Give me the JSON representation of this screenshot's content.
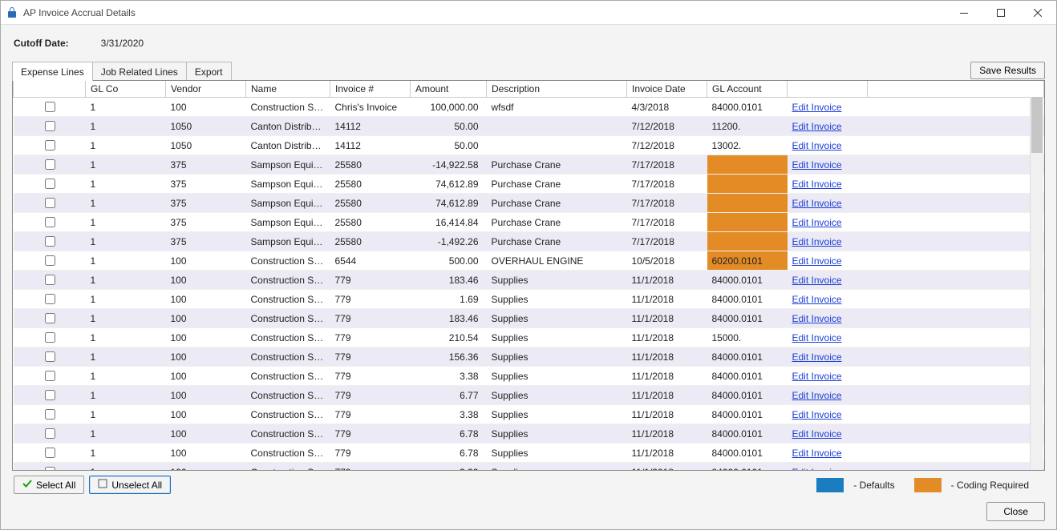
{
  "window": {
    "title": "AP Invoice Accrual Details"
  },
  "win_controls": {
    "min": "—",
    "max": "▢",
    "close": "✕"
  },
  "cutoff": {
    "label": "Cutoff Date:",
    "value": "3/31/2020"
  },
  "tabs": [
    {
      "label": "Expense Lines",
      "active": true
    },
    {
      "label": "Job Related Lines",
      "active": false
    },
    {
      "label": "Export",
      "active": false
    }
  ],
  "save_button": "Save Results",
  "columns": [
    "",
    "GL Co",
    "Vendor",
    "Name",
    "Invoice #",
    "Amount",
    "Description",
    "Invoice Date",
    "GL Account",
    "",
    ""
  ],
  "edit_link_label": "Edit Invoice",
  "rows": [
    {
      "glco": "1",
      "vendor": "100",
      "name": "Construction Sup...",
      "inv": "Chris's Invoice",
      "amount": "100,000.00",
      "desc": "wfsdf",
      "date": "4/3/2018",
      "gl": "84000.0101",
      "gl_hl": false
    },
    {
      "glco": "1",
      "vendor": "1050",
      "name": "Canton Distributin...",
      "inv": "14112",
      "amount": "50.00",
      "desc": "",
      "date": "7/12/2018",
      "gl": "11200.",
      "gl_hl": false
    },
    {
      "glco": "1",
      "vendor": "1050",
      "name": "Canton Distributin...",
      "inv": "14112",
      "amount": "50.00",
      "desc": "",
      "date": "7/12/2018",
      "gl": "13002.",
      "gl_hl": false
    },
    {
      "glco": "1",
      "vendor": "375",
      "name": "Sampson Equipm...",
      "inv": "25580",
      "amount": "-14,922.58",
      "desc": "Purchase Crane",
      "date": "7/17/2018",
      "gl": "",
      "gl_hl": true
    },
    {
      "glco": "1",
      "vendor": "375",
      "name": "Sampson Equipm...",
      "inv": "25580",
      "amount": "74,612.89",
      "desc": "Purchase Crane",
      "date": "7/17/2018",
      "gl": "",
      "gl_hl": true
    },
    {
      "glco": "1",
      "vendor": "375",
      "name": "Sampson Equipm...",
      "inv": "25580",
      "amount": "74,612.89",
      "desc": "Purchase Crane",
      "date": "7/17/2018",
      "gl": "",
      "gl_hl": true
    },
    {
      "glco": "1",
      "vendor": "375",
      "name": "Sampson Equipm...",
      "inv": "25580",
      "amount": "16,414.84",
      "desc": "Purchase Crane",
      "date": "7/17/2018",
      "gl": "",
      "gl_hl": true
    },
    {
      "glco": "1",
      "vendor": "375",
      "name": "Sampson Equipm...",
      "inv": "25580",
      "amount": "-1,492.26",
      "desc": "Purchase Crane",
      "date": "7/17/2018",
      "gl": "",
      "gl_hl": true
    },
    {
      "glco": "1",
      "vendor": "100",
      "name": "Construction Sup...",
      "inv": "6544",
      "amount": "500.00",
      "desc": "OVERHAUL ENGINE",
      "date": "10/5/2018",
      "gl": "60200.0101",
      "gl_hl": true
    },
    {
      "glco": "1",
      "vendor": "100",
      "name": "Construction Sup...",
      "inv": "779",
      "amount": "183.46",
      "desc": "Supplies",
      "date": "11/1/2018",
      "gl": "84000.0101",
      "gl_hl": false
    },
    {
      "glco": "1",
      "vendor": "100",
      "name": "Construction Sup...",
      "inv": "779",
      "amount": "1.69",
      "desc": "Supplies",
      "date": "11/1/2018",
      "gl": "84000.0101",
      "gl_hl": false
    },
    {
      "glco": "1",
      "vendor": "100",
      "name": "Construction Sup...",
      "inv": "779",
      "amount": "183.46",
      "desc": "Supplies",
      "date": "11/1/2018",
      "gl": "84000.0101",
      "gl_hl": false
    },
    {
      "glco": "1",
      "vendor": "100",
      "name": "Construction Sup...",
      "inv": "779",
      "amount": "210.54",
      "desc": "Supplies",
      "date": "11/1/2018",
      "gl": "15000.",
      "gl_hl": false
    },
    {
      "glco": "1",
      "vendor": "100",
      "name": "Construction Sup...",
      "inv": "779",
      "amount": "156.36",
      "desc": "Supplies",
      "date": "11/1/2018",
      "gl": "84000.0101",
      "gl_hl": false
    },
    {
      "glco": "1",
      "vendor": "100",
      "name": "Construction Sup...",
      "inv": "779",
      "amount": "3.38",
      "desc": "Supplies",
      "date": "11/1/2018",
      "gl": "84000.0101",
      "gl_hl": false
    },
    {
      "glco": "1",
      "vendor": "100",
      "name": "Construction Sup...",
      "inv": "779",
      "amount": "6.77",
      "desc": "Supplies",
      "date": "11/1/2018",
      "gl": "84000.0101",
      "gl_hl": false
    },
    {
      "glco": "1",
      "vendor": "100",
      "name": "Construction Sup...",
      "inv": "779",
      "amount": "3.38",
      "desc": "Supplies",
      "date": "11/1/2018",
      "gl": "84000.0101",
      "gl_hl": false
    },
    {
      "glco": "1",
      "vendor": "100",
      "name": "Construction Sup...",
      "inv": "779",
      "amount": "6.78",
      "desc": "Supplies",
      "date": "11/1/2018",
      "gl": "84000.0101",
      "gl_hl": false
    },
    {
      "glco": "1",
      "vendor": "100",
      "name": "Construction Sup...",
      "inv": "779",
      "amount": "6.78",
      "desc": "Supplies",
      "date": "11/1/2018",
      "gl": "84000.0101",
      "gl_hl": false
    },
    {
      "glco": "1",
      "vendor": "100",
      "name": "Construction Sup...",
      "inv": "779",
      "amount": "3.39",
      "desc": "Supplies",
      "date": "11/1/2018",
      "gl": "84000.0101",
      "gl_hl": false
    }
  ],
  "footer": {
    "select_all": "Select All",
    "unselect_all": "Unselect All",
    "legend_defaults": "- Defaults",
    "legend_coding": "- Coding Required"
  },
  "colors": {
    "defaults": "#1a7dbf",
    "coding": "#e38b24"
  },
  "close_button": "Close"
}
